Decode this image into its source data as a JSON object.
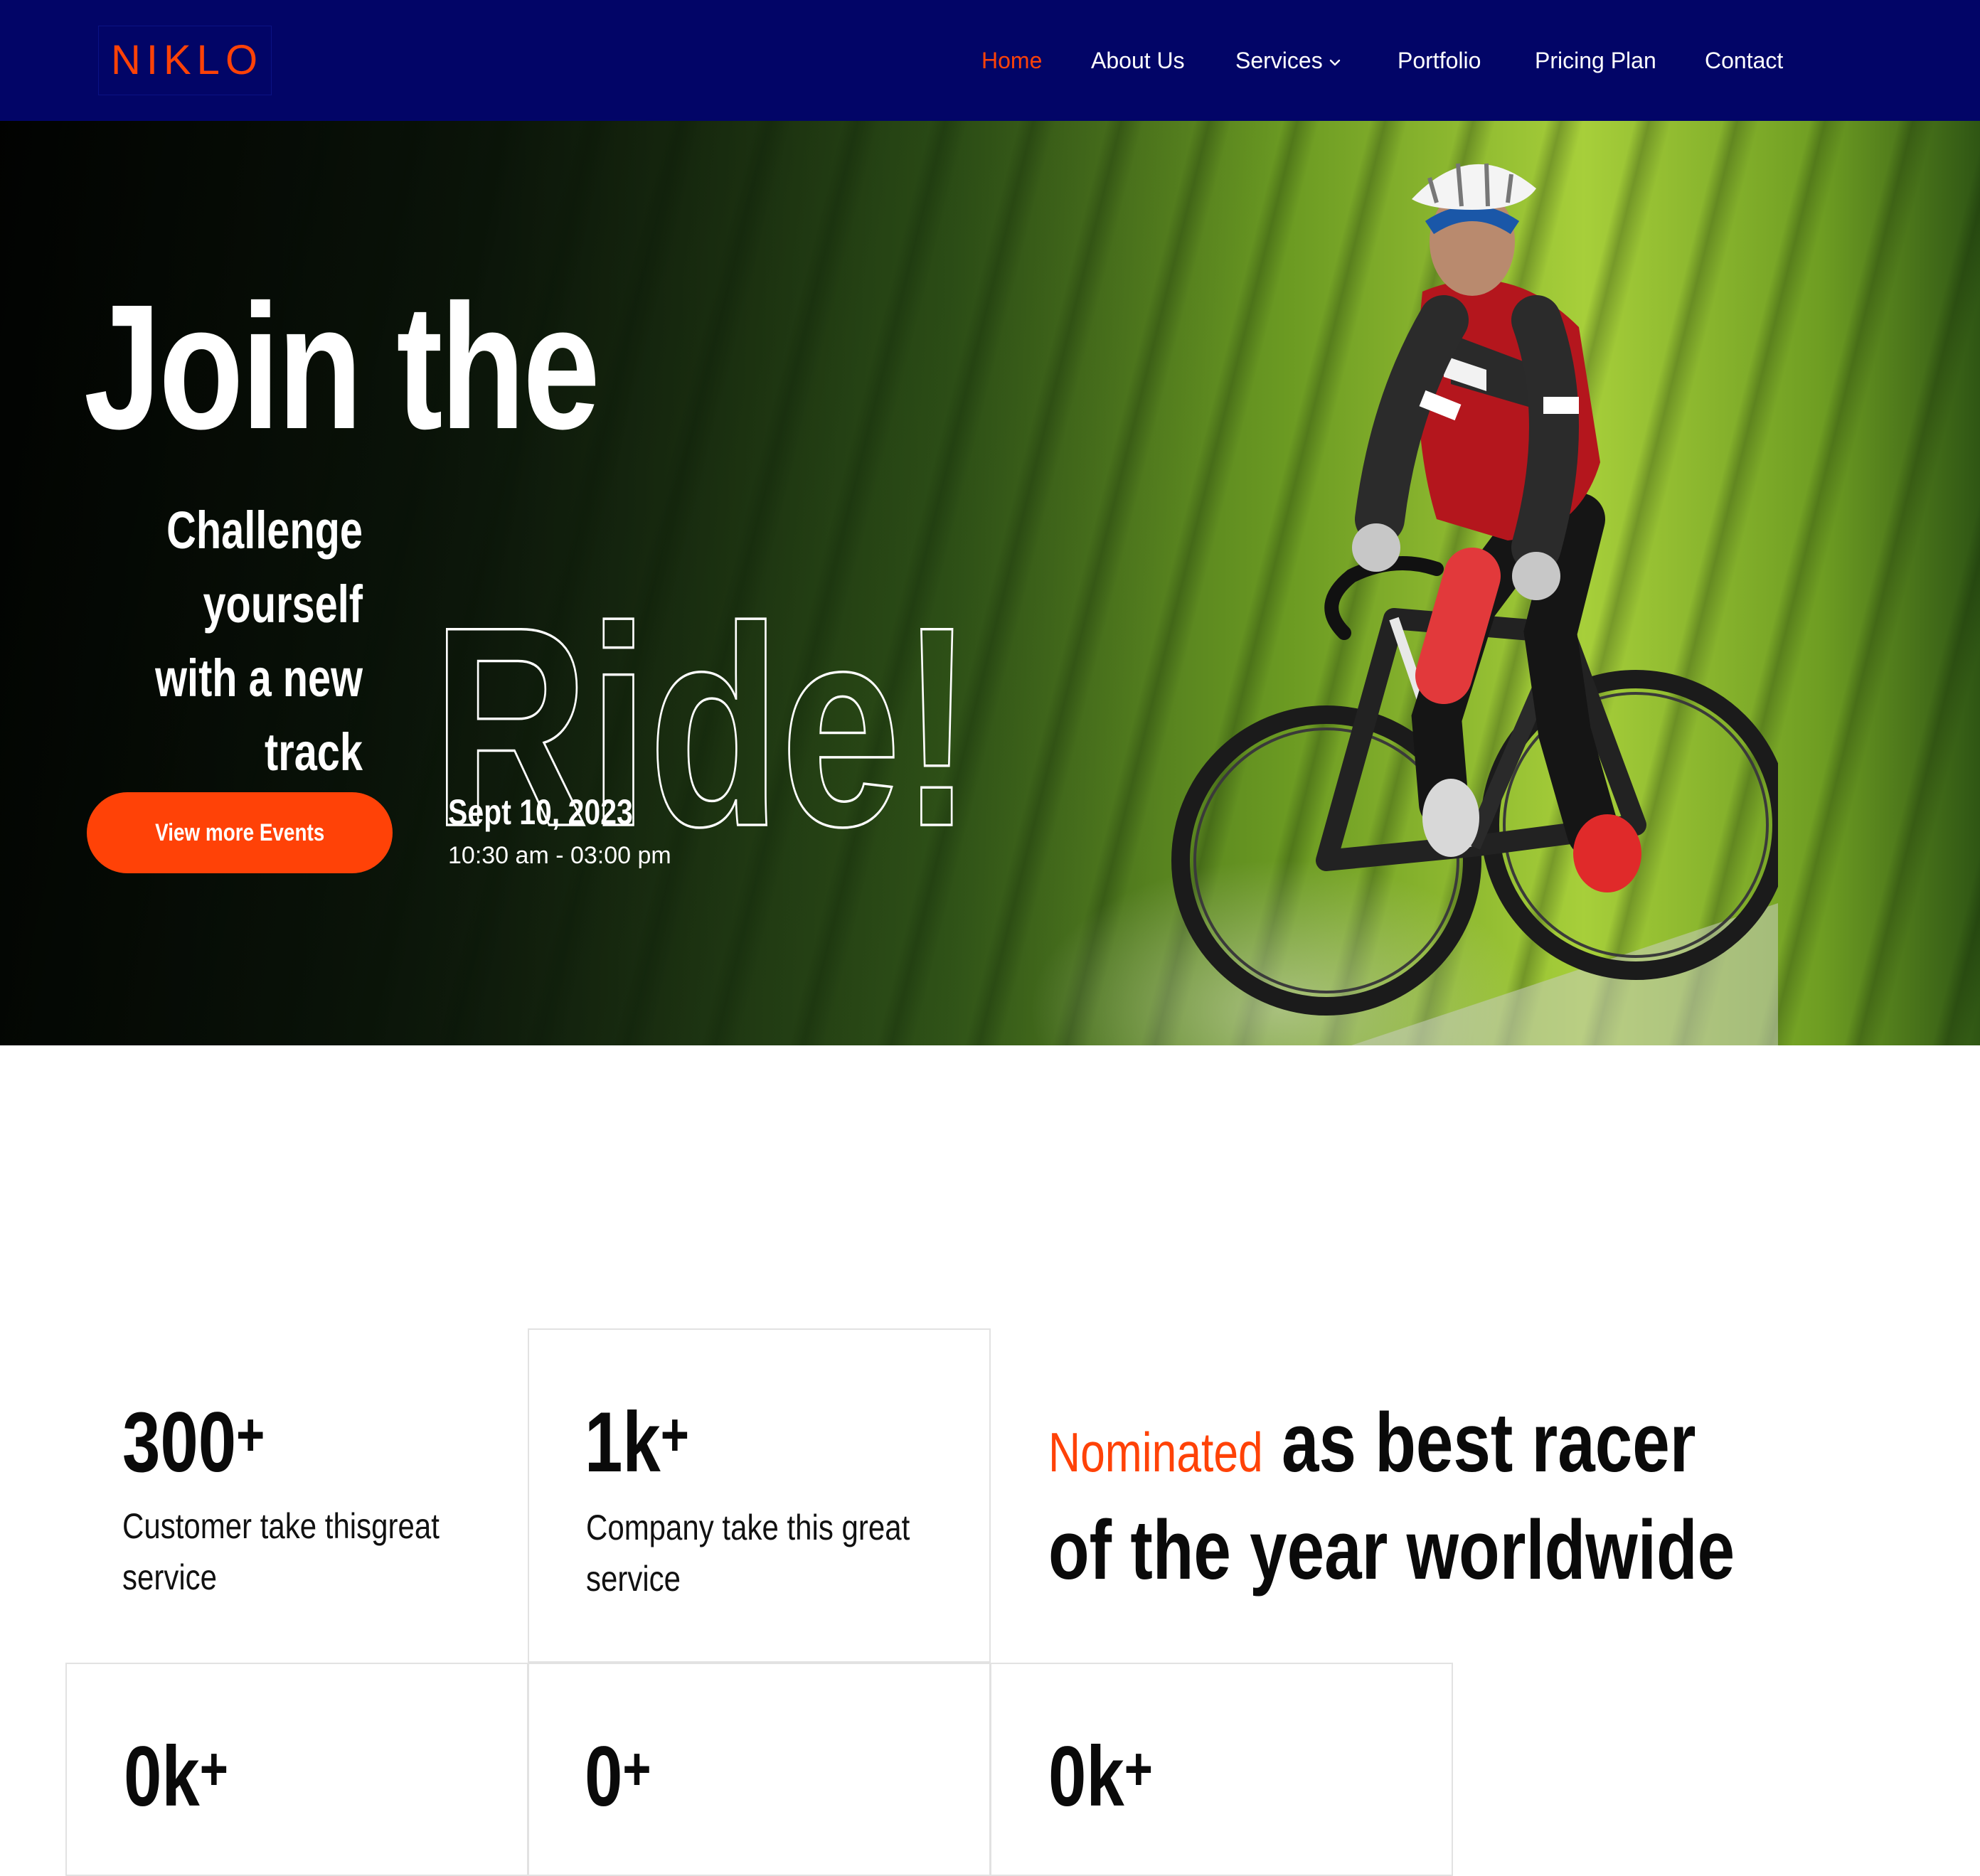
{
  "header": {
    "logo": "NIKLO",
    "nav": [
      {
        "label": "Home",
        "active": true
      },
      {
        "label": "About Us"
      },
      {
        "label": "Services",
        "has_dropdown": true
      },
      {
        "label": "Portfolio"
      },
      {
        "label": "Pricing Plan"
      },
      {
        "label": "Contact"
      }
    ]
  },
  "hero": {
    "title": "Join the",
    "subtitle": "Challenge yourself with a new track",
    "outline_word": "Ride!",
    "cta_label": "View more Events",
    "event_date": "Sept 10, 2023",
    "event_time": "10:30 am - 03:00 pm"
  },
  "stats": {
    "cards": [
      {
        "value": "300",
        "suffix": "+",
        "label": "Customer take thisgreat service"
      },
      {
        "value": "1k",
        "suffix": "+",
        "label": "Company take this great service"
      },
      {
        "value": "0k",
        "suffix": "+",
        "label": ""
      },
      {
        "value": "0",
        "suffix": "+",
        "label": ""
      },
      {
        "value": "0k",
        "suffix": "+",
        "label": ""
      }
    ],
    "headline_accent": "Nominated",
    "headline_rest": "as best racer of the year worldwide"
  },
  "colors": {
    "header_bg": "#020567",
    "accent": "#ff4207",
    "text_dark": "#0a0a0a",
    "card_border": "#e2e2e2"
  }
}
